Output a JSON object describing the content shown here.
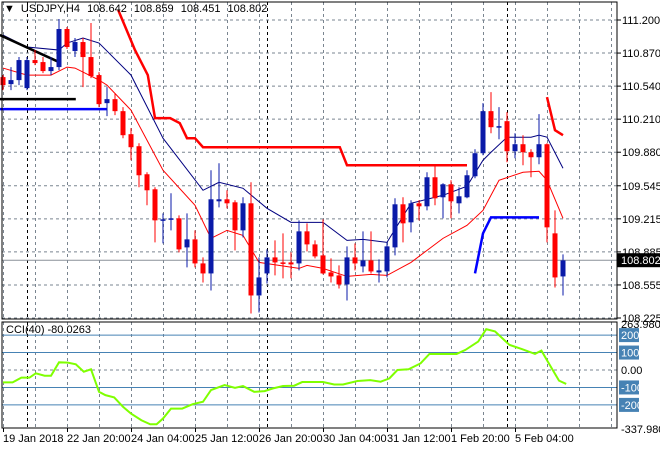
{
  "header": {
    "symbol": "USDJPY,H4",
    "open": "108.642",
    "high": "108.859",
    "low": "108.451",
    "close": "108.802"
  },
  "cci_header": {
    "name": "CCI(40)",
    "value": "-80.0263"
  },
  "colors": {
    "bull": "#0a1aa8",
    "bear": "#ff0000",
    "ma_fast": "#000080",
    "ma_slow": "#ff0000",
    "cci": "#7fff00",
    "level": "#4682b4",
    "grid": "#7a8590"
  },
  "chart_data": [
    {
      "type": "candlestick",
      "title": "USDJPY,H4",
      "ylim": [
        108.225,
        111.2
      ],
      "yticks": [
        "111.200",
        "110.870",
        "110.540",
        "110.210",
        "109.880",
        "109.545",
        "109.215",
        "108.885",
        "108.555",
        "108.225"
      ],
      "current_price": "108.802",
      "xticks": [
        "19 Jan 2018",
        "22 Jan 20:00",
        "24 Jan 04:00",
        "25 Jan 12:00",
        "26 Jan 20:00",
        "30 Jan 04:00",
        "31 Jan 12:00",
        "1 Feb 20:00",
        "5 Feb 04:00"
      ],
      "candles_ohlc": [
        [
          110.63,
          110.65,
          110.5,
          110.55
        ],
        [
          110.56,
          110.73,
          110.5,
          110.6
        ],
        [
          110.6,
          110.83,
          110.55,
          110.8
        ],
        [
          110.52,
          110.83,
          110.5,
          110.8
        ],
        [
          110.8,
          110.9,
          110.75,
          110.77
        ],
        [
          110.78,
          110.83,
          110.67,
          110.69
        ],
        [
          110.69,
          110.83,
          110.65,
          110.73
        ],
        [
          110.73,
          111.21,
          110.7,
          111.11
        ],
        [
          111.11,
          111.13,
          110.91,
          110.93
        ],
        [
          110.89,
          111.02,
          110.83,
          110.98
        ],
        [
          110.98,
          111.02,
          110.53,
          110.83
        ],
        [
          110.83,
          111.17,
          110.62,
          110.64
        ],
        [
          110.65,
          110.68,
          110.33,
          110.36
        ],
        [
          110.37,
          110.53,
          110.24,
          110.41
        ],
        [
          110.41,
          110.47,
          110.25,
          110.29
        ],
        [
          110.29,
          110.33,
          110.02,
          110.05
        ],
        [
          110.06,
          110.12,
          109.8,
          109.93
        ],
        [
          109.94,
          109.97,
          109.53,
          109.65
        ],
        [
          109.66,
          109.68,
          109.35,
          109.5
        ],
        [
          109.51,
          109.53,
          108.98,
          109.2
        ],
        [
          109.2,
          109.27,
          108.97,
          109.21
        ],
        [
          109.21,
          109.47,
          109.1,
          109.22
        ],
        [
          109.22,
          109.25,
          108.88,
          108.91
        ],
        [
          108.93,
          109.27,
          108.73,
          109.01
        ],
        [
          109.01,
          109.1,
          108.73,
          108.77
        ],
        [
          108.77,
          108.83,
          108.58,
          108.67
        ],
        [
          108.67,
          109.7,
          108.5,
          109.41
        ],
        [
          109.39,
          109.77,
          109.33,
          109.41
        ],
        [
          109.41,
          109.5,
          109.32,
          109.37
        ],
        [
          109.38,
          109.4,
          108.9,
          109.1
        ],
        [
          109.1,
          109.43,
          109.03,
          109.37
        ],
        [
          109.37,
          109.58,
          108.27,
          108.45
        ],
        [
          108.45,
          108.83,
          108.28,
          108.63
        ],
        [
          108.67,
          108.91,
          108.57,
          108.83
        ],
        [
          108.83,
          109.0,
          108.65,
          108.78
        ],
        [
          108.78,
          109.07,
          108.62,
          108.77
        ],
        [
          108.78,
          108.88,
          108.62,
          108.76
        ],
        [
          108.77,
          109.2,
          108.7,
          109.09
        ],
        [
          109.09,
          109.17,
          108.89,
          108.96
        ],
        [
          108.96,
          109.0,
          108.82,
          108.84
        ],
        [
          108.85,
          109.21,
          108.66,
          108.67
        ],
        [
          108.68,
          108.82,
          108.58,
          108.64
        ],
        [
          108.65,
          108.75,
          108.52,
          108.56
        ],
        [
          108.56,
          108.94,
          108.4,
          108.83
        ],
        [
          108.83,
          108.97,
          108.7,
          108.77
        ],
        [
          108.74,
          109.09,
          108.68,
          108.8
        ],
        [
          108.8,
          109.09,
          108.67,
          108.69
        ],
        [
          108.68,
          108.81,
          108.58,
          108.7
        ],
        [
          108.69,
          108.98,
          108.63,
          108.94
        ],
        [
          108.93,
          109.42,
          108.85,
          109.36
        ],
        [
          109.36,
          109.43,
          108.98,
          109.17
        ],
        [
          109.18,
          109.4,
          109.08,
          109.37
        ],
        [
          109.37,
          109.4,
          109.2,
          109.34
        ],
        [
          109.34,
          109.68,
          109.3,
          109.63
        ],
        [
          109.63,
          109.75,
          109.35,
          109.42
        ],
        [
          109.43,
          109.57,
          109.22,
          109.56
        ],
        [
          109.56,
          109.6,
          109.22,
          109.39
        ],
        [
          109.37,
          109.53,
          109.27,
          109.44
        ],
        [
          109.43,
          109.7,
          109.42,
          109.65
        ],
        [
          109.64,
          109.91,
          109.62,
          109.87
        ],
        [
          109.87,
          110.37,
          109.85,
          110.29
        ],
        [
          110.29,
          110.48,
          110.07,
          110.13
        ],
        [
          110.13,
          110.33,
          110.01,
          110.14
        ],
        [
          110.19,
          110.28,
          109.78,
          109.89
        ],
        [
          109.89,
          110.07,
          109.82,
          109.96
        ],
        [
          109.96,
          110.05,
          109.75,
          109.88
        ],
        [
          109.88,
          109.91,
          109.63,
          109.83
        ],
        [
          109.83,
          110.26,
          109.76,
          109.96
        ],
        [
          109.96,
          109.97,
          108.98,
          109.13
        ],
        [
          109.07,
          109.3,
          108.53,
          108.63
        ],
        [
          108.64,
          108.86,
          108.45,
          108.8
        ]
      ],
      "overlays": [
        {
          "name": "ma-fast",
          "color": "#000080",
          "points": [
            [
              0,
              111.05
            ],
            [
              3,
              110.93
            ],
            [
              7,
              110.9
            ],
            [
              8,
              110.97
            ],
            [
              10,
              111.02
            ],
            [
              12,
              110.97
            ],
            [
              16,
              110.65
            ],
            [
              20,
              110.02
            ],
            [
              25,
              109.5
            ],
            [
              27,
              109.58
            ],
            [
              30,
              109.52
            ],
            [
              33,
              109.32
            ],
            [
              36,
              109.18
            ],
            [
              40,
              109.18
            ],
            [
              43,
              109.0
            ],
            [
              45,
              109.01
            ],
            [
              48,
              108.98
            ],
            [
              51,
              109.37
            ],
            [
              55,
              109.45
            ],
            [
              58,
              109.54
            ],
            [
              60,
              109.8
            ],
            [
              61,
              109.88
            ],
            [
              63,
              110.03
            ],
            [
              66,
              110.03
            ],
            [
              67,
              110.05
            ],
            [
              68,
              110.03
            ],
            [
              70,
              109.72
            ]
          ]
        },
        {
          "name": "ma-slow",
          "color": "#ff0000",
          "points": [
            [
              0,
              110.72
            ],
            [
              3,
              110.65
            ],
            [
              6,
              110.65
            ],
            [
              8,
              110.73
            ],
            [
              9,
              110.72
            ],
            [
              12,
              110.6
            ],
            [
              13,
              110.55
            ],
            [
              16,
              110.3
            ],
            [
              20,
              109.7
            ],
            [
              24,
              109.35
            ],
            [
              26,
              109.02
            ],
            [
              28,
              109.1
            ],
            [
              30,
              109.05
            ],
            [
              32,
              108.78
            ],
            [
              37,
              108.72
            ],
            [
              38,
              108.75
            ],
            [
              40,
              108.72
            ],
            [
              43,
              108.64
            ],
            [
              46,
              108.66
            ],
            [
              48,
              108.65
            ],
            [
              51,
              108.78
            ],
            [
              55,
              109.02
            ],
            [
              58,
              109.15
            ],
            [
              60,
              109.3
            ],
            [
              61,
              109.45
            ],
            [
              62,
              109.6
            ],
            [
              65,
              109.68
            ],
            [
              67,
              109.69
            ],
            [
              68,
              109.6
            ],
            [
              70,
              109.22
            ]
          ]
        },
        {
          "name": "stop-line-upper-1",
          "color": "#ff0000",
          "thick": true,
          "points": [
            [
              14.4,
              111.3
            ],
            [
              16.5,
              110.9
            ],
            [
              18.1,
              110.65
            ],
            [
              19,
              110.22
            ],
            [
              20.9,
              110.22
            ],
            [
              22.1,
              110.17
            ],
            [
              23,
              110.02
            ],
            [
              24,
              110.02
            ],
            [
              25,
              109.93
            ],
            [
              42.1,
              109.93
            ],
            [
              43,
              109.75
            ],
            [
              58,
              109.75
            ]
          ]
        },
        {
          "name": "stop-line-upper-2",
          "color": "#ff0000",
          "thick": true,
          "points": [
            [
              68,
              110.43
            ],
            [
              69,
              110.1
            ],
            [
              70,
              110.05
            ]
          ]
        },
        {
          "name": "support-line-1",
          "color": "#0000ff",
          "thick": true,
          "points": [
            [
              -0.4,
              110.31
            ],
            [
              13,
              110.31
            ]
          ]
        },
        {
          "name": "support-line-2",
          "color": "#0000ff",
          "thick": true,
          "points": [
            [
              59,
              108.67
            ],
            [
              60,
              109.07
            ],
            [
              61,
              109.23
            ],
            [
              67,
              109.23
            ]
          ]
        },
        {
          "name": "trend-line",
          "color": "#000000",
          "thick": true,
          "points": [
            [
              -0.4,
              111.05
            ],
            [
              7,
              110.78
            ]
          ]
        },
        {
          "name": "level-line",
          "color": "#000000",
          "thick": true,
          "points": [
            [
              -0.4,
              110.41
            ],
            [
              9.1,
              110.41
            ]
          ]
        }
      ]
    },
    {
      "type": "line",
      "title": "CCI(40)",
      "ylim": [
        -337.9806,
        263.9807
      ],
      "yticks": [
        "263.9807",
        "200",
        "100",
        "0.00",
        "-100",
        "-200",
        "-337.9806"
      ],
      "levels": [
        200,
        100,
        -100,
        -200
      ],
      "series": [
        {
          "name": "CCI(40)",
          "points": [
            [
              0,
              -71
            ],
            [
              1.2,
              -71
            ],
            [
              2.3,
              -44
            ],
            [
              3.3,
              -44
            ],
            [
              4.1,
              -19
            ],
            [
              5.2,
              -33
            ],
            [
              6,
              -33
            ],
            [
              7,
              44
            ],
            [
              8.1,
              42
            ],
            [
              9.1,
              33
            ],
            [
              10.1,
              -10
            ],
            [
              11,
              4
            ],
            [
              12,
              -125
            ],
            [
              12.8,
              -144
            ],
            [
              13.9,
              -157
            ],
            [
              15,
              -211
            ],
            [
              16,
              -250
            ],
            [
              17.3,
              -288
            ],
            [
              18.4,
              -311
            ],
            [
              19.2,
              -311
            ],
            [
              20,
              -278
            ],
            [
              21,
              -221
            ],
            [
              22.4,
              -221
            ],
            [
              23.7,
              -196
            ],
            [
              25,
              -182
            ],
            [
              26,
              -115
            ],
            [
              27.7,
              -86
            ],
            [
              29,
              -102
            ],
            [
              30,
              -92
            ],
            [
              31.4,
              -125
            ],
            [
              32.7,
              -121
            ],
            [
              33.7,
              -106
            ],
            [
              35,
              -92
            ],
            [
              36.4,
              -90
            ],
            [
              37.4,
              -69
            ],
            [
              40,
              -69
            ],
            [
              41.4,
              -83
            ],
            [
              42.5,
              -83
            ],
            [
              44.3,
              -63
            ],
            [
              45.9,
              -58
            ],
            [
              47.2,
              -67
            ],
            [
              48.3,
              -48
            ],
            [
              49.3,
              0
            ],
            [
              50.7,
              4
            ],
            [
              52.2,
              38
            ],
            [
              53.3,
              92
            ],
            [
              56.7,
              92
            ],
            [
              57.8,
              115
            ],
            [
              59.4,
              163
            ],
            [
              60.4,
              234
            ],
            [
              61.5,
              221
            ],
            [
              63.3,
              144
            ],
            [
              64.9,
              119
            ],
            [
              66.5,
              92
            ],
            [
              67.3,
              111
            ],
            [
              68.1,
              48
            ],
            [
              69.5,
              -61
            ],
            [
              70.4,
              -80.03
            ]
          ]
        }
      ]
    }
  ]
}
